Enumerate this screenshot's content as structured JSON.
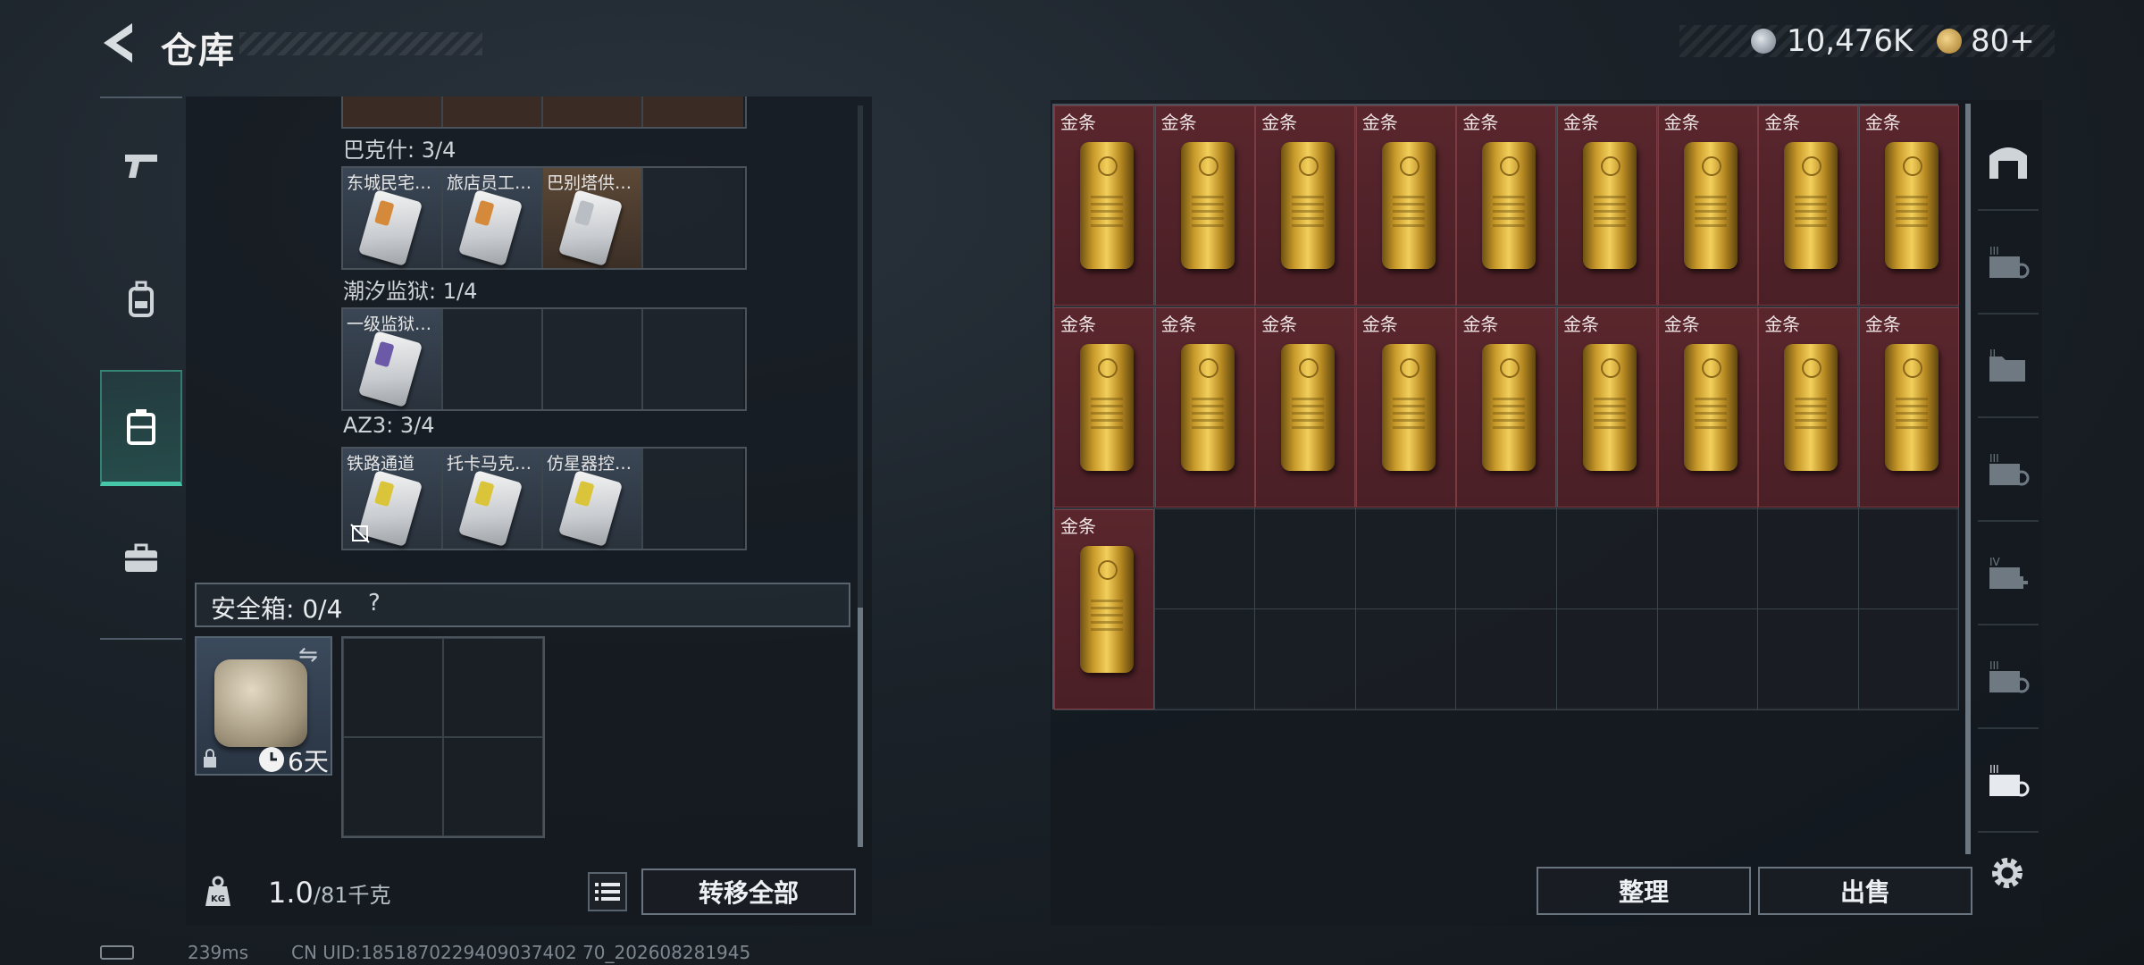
{
  "header": {
    "title": "仓库",
    "currency_primary": "10,476K",
    "currency_secondary": "80+"
  },
  "left_nav": {
    "items": [
      {
        "icon": "pistol-icon"
      },
      {
        "icon": "backpack-icon"
      },
      {
        "icon": "storage-case-icon",
        "active": true
      },
      {
        "icon": "briefcase-icon"
      }
    ]
  },
  "keycards": {
    "groups": [
      {
        "label": "巴克什: 3/4",
        "slots": [
          "东城民宅…",
          "旅店员工…",
          "巴别塔供…",
          ""
        ]
      },
      {
        "label": "潮汐监狱: 1/4",
        "slots": [
          "一级监狱…",
          "",
          "",
          ""
        ]
      },
      {
        "label": "AZ3: 3/4",
        "slots": [
          "铁路通道",
          "托卡马克…",
          "仿星器控…",
          ""
        ]
      }
    ]
  },
  "safebox": {
    "label": "安全箱:  0/4",
    "help": "?",
    "duration": "6天"
  },
  "capacity": {
    "current": "1.0",
    "max": "/81千克"
  },
  "buttons": {
    "transfer_all": "转移全部",
    "sort": "整理",
    "sell": "出售"
  },
  "storage": {
    "items": [
      "金条",
      "金条",
      "金条",
      "金条",
      "金条",
      "金条",
      "金条",
      "金条",
      "金条",
      "金条",
      "金条",
      "金条",
      "金条",
      "金条",
      "金条",
      "金条",
      "金条",
      "金条",
      "金条"
    ]
  },
  "status_bar": {
    "ping": "239ms",
    "uid": "CN UID:1851870229409037402 70_202608281945"
  },
  "colors": {
    "accent": "#46c8a8",
    "gold_cell_bg": "#4a1f26",
    "panel_bg": "#141a20"
  }
}
